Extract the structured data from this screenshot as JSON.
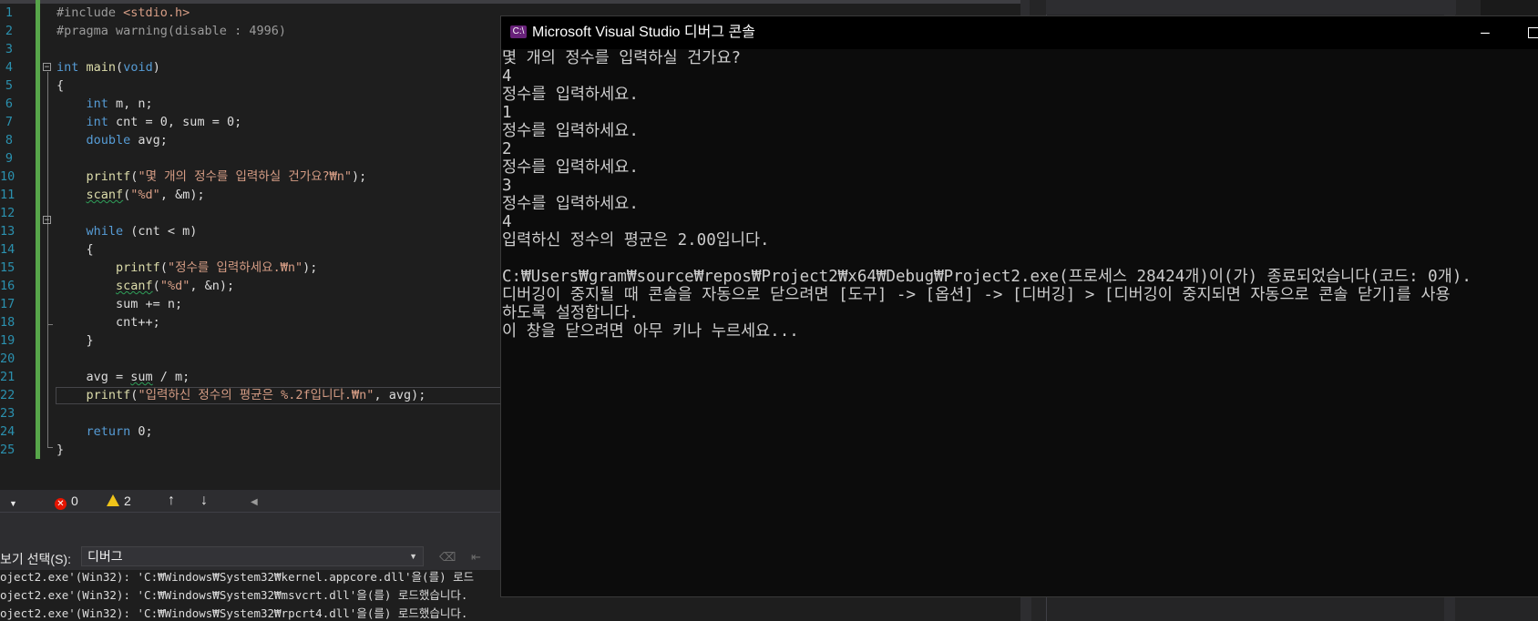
{
  "editor": {
    "lines": [
      {
        "n": "1",
        "code": "#include <stdio.h>"
      },
      {
        "n": "2",
        "code": "#pragma warning(disable : 4996)"
      },
      {
        "n": "3",
        "code": ""
      },
      {
        "n": "4",
        "code": "int main(void)"
      },
      {
        "n": "5",
        "code": "{"
      },
      {
        "n": "6",
        "code": "    int m, n;"
      },
      {
        "n": "7",
        "code": "    int cnt = 0, sum = 0;"
      },
      {
        "n": "8",
        "code": "    double avg;"
      },
      {
        "n": "9",
        "code": ""
      },
      {
        "n": "10",
        "code": "    printf(\"몇 개의 정수를 입력하실 건가요?₩n\");"
      },
      {
        "n": "11",
        "code": "    scanf(\"%d\", &m);"
      },
      {
        "n": "12",
        "code": ""
      },
      {
        "n": "13",
        "code": "    while (cnt < m)"
      },
      {
        "n": "14",
        "code": "    {"
      },
      {
        "n": "15",
        "code": "        printf(\"정수를 입력하세요.₩n\");"
      },
      {
        "n": "16",
        "code": "        scanf(\"%d\", &n);"
      },
      {
        "n": "17",
        "code": "        sum += n;"
      },
      {
        "n": "18",
        "code": "        cnt++;"
      },
      {
        "n": "19",
        "code": "    }"
      },
      {
        "n": "20",
        "code": ""
      },
      {
        "n": "21",
        "code": "    avg = sum / m;"
      },
      {
        "n": "22",
        "code": "    printf(\"입력하신 정수의 평균은 %.2f입니다.₩n\", avg);"
      },
      {
        "n": "23",
        "code": ""
      },
      {
        "n": "24",
        "code": "    return 0;"
      },
      {
        "n": "25",
        "code": "}"
      }
    ]
  },
  "status": {
    "errors": "0",
    "warnings": "2"
  },
  "output": {
    "show_label": "보기 선택(S):",
    "source": "디버그",
    "lines": [
      "oject2.exe'(Win32): 'C:₩Windows₩System32₩kernel.appcore.dll'을(를) 로드",
      "oject2.exe'(Win32): 'C:₩Windows₩System32₩msvcrt.dll'을(를) 로드했습니다.",
      "oject2.exe'(Win32): 'C:₩Windows₩System32₩rpcrt4.dll'을(를) 로드했습니다."
    ]
  },
  "console": {
    "title": "Microsoft Visual Studio 디버그 콘솔",
    "icon_label": "C:\\",
    "lines": [
      "몇 개의 정수를 입력하실 건가요?",
      "4",
      "정수를 입력하세요.",
      "1",
      "정수를 입력하세요.",
      "2",
      "정수를 입력하세요.",
      "3",
      "정수를 입력하세요.",
      "4",
      "입력하신 정수의 평균은 2.00입니다.",
      "",
      "C:₩Users₩gram₩source₩repos₩Project2₩x64₩Debug₩Project2.exe(프로세스 28424개)이(가) 종료되었습니다(코드: 0개).",
      "디버깅이 중지될 때 콘솔을 자동으로 닫으려면 [도구] -> [옵션] -> [디버깅] > [디버깅이 중지되면 자동으로 콘솔 닫기]를 사용",
      "하도록 설정합니다.",
      "이 창을 닫으려면 아무 키나 누르세요..."
    ]
  },
  "icons": {
    "error": "error-circle-icon",
    "warning": "warning-triangle-icon",
    "up": "arrow-up-icon",
    "down": "arrow-down-icon"
  }
}
